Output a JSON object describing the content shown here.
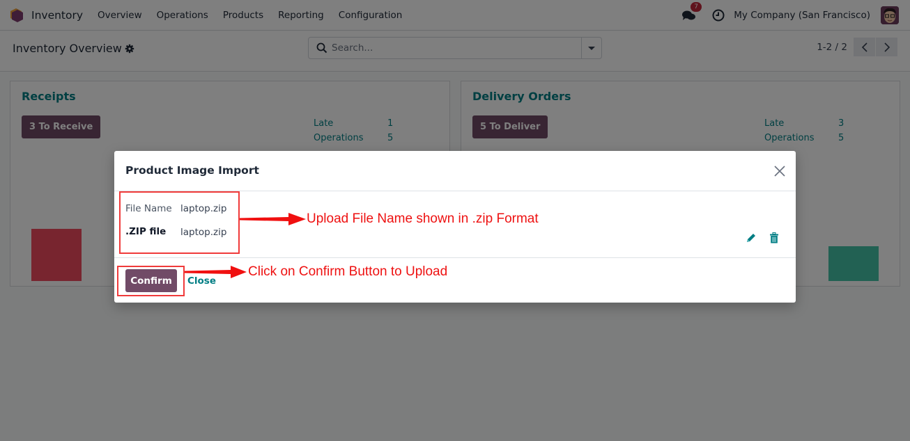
{
  "navbar": {
    "app_name": "Inventory",
    "menu": [
      "Overview",
      "Operations",
      "Products",
      "Reporting",
      "Configuration"
    ],
    "messages_badge": "7",
    "company": "My Company (San Francisco)",
    "icons": {
      "chat": "chat-bubbles-icon",
      "activity": "clock-icon"
    }
  },
  "control_panel": {
    "title": "Inventory Overview",
    "search_placeholder": "Search...",
    "pager": "1-2 / 2"
  },
  "cards": [
    {
      "title": "Receipts",
      "button": "3 To Receive",
      "stats": [
        {
          "label": "Late",
          "value": "1"
        },
        {
          "label": "Operations",
          "value": "5"
        }
      ],
      "bar_color": "#f04a5e"
    },
    {
      "title": "Delivery Orders",
      "button": "5 To Deliver",
      "stats": [
        {
          "label": "Late",
          "value": "3"
        },
        {
          "label": "Operations",
          "value": "5"
        }
      ],
      "bar_color": "#44c2a7"
    }
  ],
  "modal": {
    "title": "Product Image Import",
    "fields": [
      {
        "label": "File Name",
        "value": "laptop.zip"
      },
      {
        "label": ".ZIP file",
        "value": "laptop.zip"
      }
    ],
    "confirm_label": "Confirm",
    "close_label": "Close"
  },
  "annotations": {
    "upload_note": "Upload File Name shown in .zip Format",
    "confirm_note": "Click on Confirm Button to Upload"
  },
  "colors": {
    "primary": "#714b67",
    "link": "#017e84",
    "annotation": "#ee1111"
  }
}
